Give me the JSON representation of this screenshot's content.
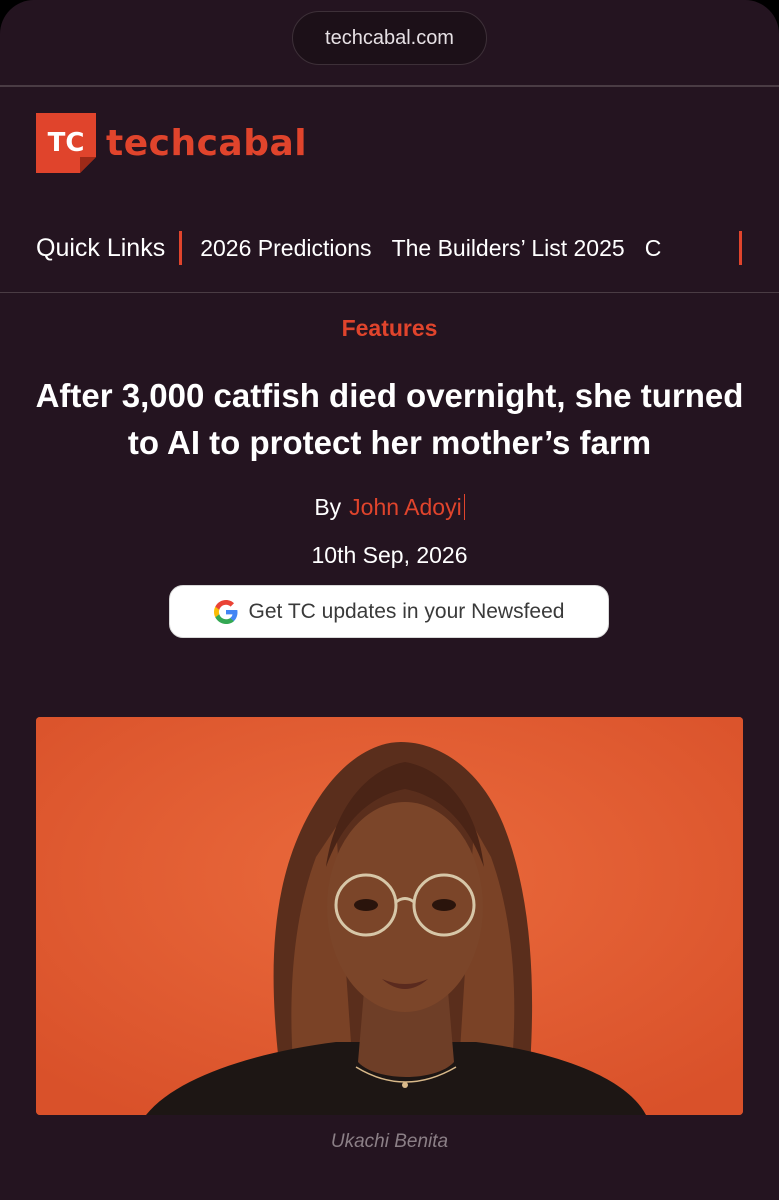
{
  "browser": {
    "url": "techcabal.com"
  },
  "site": {
    "logo_mark": "TC",
    "name": "techcabal",
    "brand_color": "#e0442c",
    "background_color": "#241420"
  },
  "quick_links": {
    "title": "Quick Links",
    "items": [
      "2026 Predictions",
      "The Builders’ List 2025",
      "C"
    ]
  },
  "article": {
    "category": "Features",
    "headline": "After 3,000 catfish died overnight, she turned to AI to protect her mother’s farm",
    "by_label": "By",
    "author": "John Adoyi",
    "date": "10th Sep, 2026"
  },
  "newsfeed_button": {
    "icon": "google-g-icon",
    "label": "Get TC updates in your Newsfeed"
  },
  "hero_image": {
    "caption": "Ukachi Benita"
  }
}
